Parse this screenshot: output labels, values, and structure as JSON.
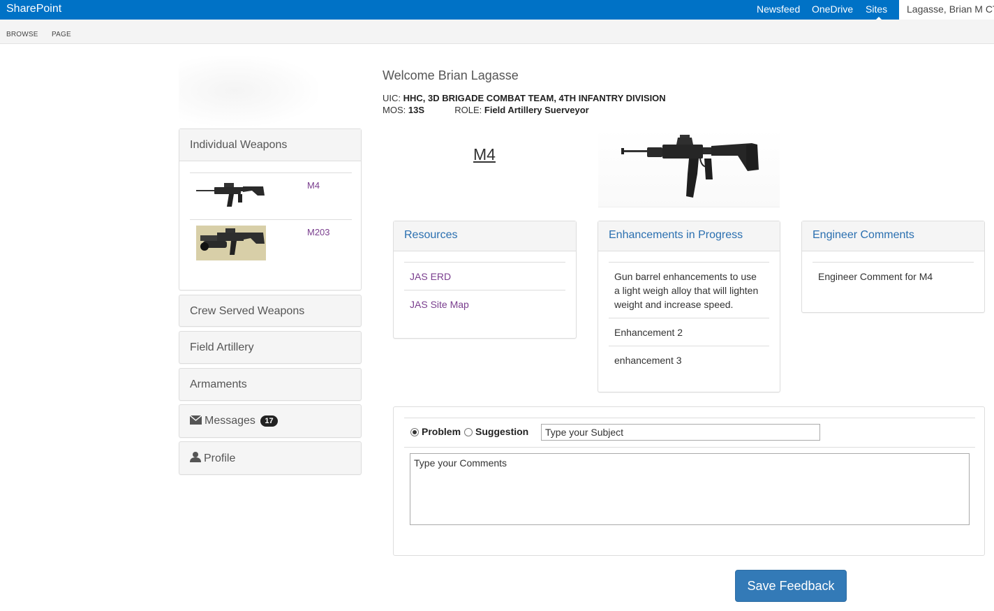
{
  "suitebar": {
    "brand": "SharePoint",
    "nav": [
      "Newsfeed",
      "OneDrive",
      "Sites"
    ],
    "user": "Lagasse, Brian M CTR"
  },
  "ribbon": {
    "tabs": [
      "BROWSE",
      "PAGE"
    ]
  },
  "header": {
    "welcome": "Welcome Brian Lagasse",
    "uic_label": "UIC:",
    "uic_value": "HHC, 3D BRIGADE COMBAT TEAM, 4TH INFANTRY DIVISION",
    "mos_label": "MOS:",
    "mos_value": "13S",
    "role_label": "ROLE:",
    "role_value": "Field Artillery Suerveyor"
  },
  "sidebar": {
    "individual_weapons": {
      "title": "Individual Weapons",
      "items": [
        {
          "label": "M4"
        },
        {
          "label": "M203"
        }
      ]
    },
    "crew_served": "Crew Served Weapons",
    "field_artillery": "Field Artillery",
    "armaments": "Armaments",
    "messages": {
      "label": "Messages",
      "count": "17"
    },
    "profile": "Profile"
  },
  "weapon": {
    "title": "M4"
  },
  "resources": {
    "title": "Resources",
    "links": [
      "JAS ERD",
      "JAS Site Map"
    ]
  },
  "enhancements": {
    "title": "Enhancements in Progress",
    "items": [
      "Gun barrel enhancements to use a light weigh alloy that will lighten weight and increase speed.",
      "Enhancement 2",
      "enhancement 3"
    ]
  },
  "engineer": {
    "title": "Engineer Comments",
    "items": [
      "Engineer Comment for M4"
    ]
  },
  "feedback": {
    "problem_label": "Problem",
    "suggestion_label": "Suggestion",
    "subject_placeholder": "Type your Subject",
    "comments_placeholder": "Type your Comments",
    "save_label": "Save Feedback"
  },
  "colors": {
    "suitebar": "#0072c6",
    "link_purple": "#7a3e8e",
    "card_title_blue": "#2a6fb0",
    "button_blue": "#337ab7"
  }
}
